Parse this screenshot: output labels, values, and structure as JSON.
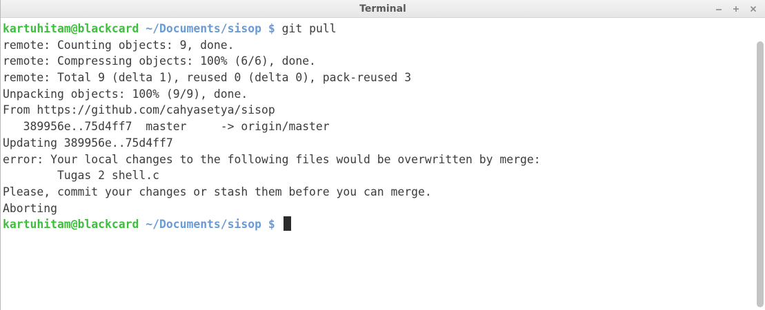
{
  "window": {
    "title": "Terminal",
    "controls": {
      "minimize": "–",
      "maximize": "+",
      "close": "×"
    }
  },
  "terminal": {
    "prompt1": {
      "user": "kartuhitam@blackcard",
      "path": "~/Documents/sisop $",
      "command": "git pull"
    },
    "output": [
      "remote: Counting objects: 9, done.",
      "remote: Compressing objects: 100% (6/6), done.",
      "remote: Total 9 (delta 1), reused 0 (delta 0), pack-reused 3",
      "Unpacking objects: 100% (9/9), done.",
      "From https://github.com/cahyasetya/sisop",
      "   389956e..75d4ff7  master     -> origin/master",
      "Updating 389956e..75d4ff7",
      "error: Your local changes to the following files would be overwritten by merge:",
      "        Tugas 2 shell.c",
      "Please, commit your changes or stash them before you can merge.",
      "Aborting"
    ],
    "prompt2": {
      "user": "kartuhitam@blackcard",
      "path": "~/Documents/sisop $",
      "command": ""
    }
  },
  "colors": {
    "user": "#3cbf3c",
    "path": "#6a9bd4",
    "text": "#3c3c3c",
    "title": "#5a5a5a"
  },
  "icons": {
    "minimize": "minimize-icon",
    "maximize": "maximize-icon",
    "close": "close-icon"
  }
}
